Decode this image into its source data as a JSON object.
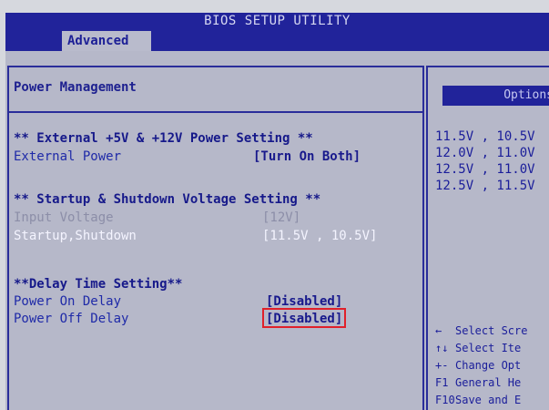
{
  "app": {
    "title": "BIOS SETUP UTILITY",
    "active_tab": "Advanced"
  },
  "main": {
    "title": "Power Management",
    "sections": [
      {
        "header": "** External +5V & +12V Power Setting **",
        "items": [
          {
            "label": "External Power",
            "value": "[Turn On  Both]"
          }
        ]
      },
      {
        "header": "** Startup & Shutdown Voltage Setting **",
        "items": [
          {
            "label": "Input Voltage",
            "value": "[12V]"
          },
          {
            "label": "Startup,Shutdown",
            "value": "[11.5V , 10.5V]"
          }
        ]
      },
      {
        "header": "**Delay Time Setting**",
        "items": [
          {
            "label": "Power On Delay",
            "value": "[Disabled]"
          },
          {
            "label": "Power Off Delay",
            "value": "[Disabled]"
          }
        ]
      }
    ]
  },
  "side": {
    "options_header": "Options",
    "options": [
      "11.5V , 10.5V",
      "12.0V , 11.0V",
      "12.5V , 11.0V",
      "12.5V , 11.5V"
    ],
    "help": [
      {
        "key": "←",
        "text": "Select Scre"
      },
      {
        "key": "↑↓",
        "text": "Select Ite"
      },
      {
        "key": "+-",
        "text": "Change Opt"
      },
      {
        "key": "F1",
        "text": "General He"
      },
      {
        "key": "F10",
        "text": "Save and E"
      }
    ]
  }
}
